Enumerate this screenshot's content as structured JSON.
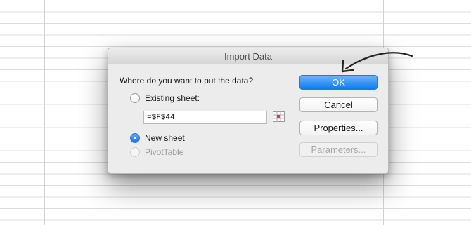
{
  "dialog": {
    "title": "Import Data",
    "question": "Where do you want to put the data?",
    "options": {
      "existing_sheet": "Existing sheet:",
      "new_sheet": "New sheet",
      "pivot_table": "PivotTable"
    },
    "selected_option": "new_sheet",
    "cell_reference": "=$F$44",
    "buttons": {
      "ok": "OK",
      "cancel": "Cancel",
      "properties": "Properties...",
      "parameters": "Parameters..."
    }
  },
  "colors": {
    "primary_button": "#1a82f4",
    "dialog_background": "#ececec",
    "annotation_arrow": "#222222"
  }
}
